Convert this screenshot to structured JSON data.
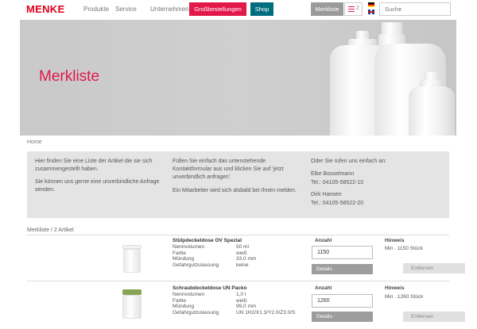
{
  "header": {
    "logo": "MENKE",
    "nav": [
      "Produkte",
      "Service",
      "Unternehmen"
    ],
    "gross_label": "Großbestellungen",
    "shop_label": "Shop",
    "merkliste_label": "Merkliste",
    "merkliste_count": "2",
    "search_placeholder": "Suche",
    "languages": [
      "de-flag",
      "en-flag"
    ]
  },
  "hero": {
    "title": "Merkliste"
  },
  "breadcrumb": "Home",
  "info": {
    "col1_p1": "Hier finden Sie eine Liste der Artikel die sie sich zusammengestellt haben.",
    "col1_p2": "Sie können uns gerne eine unverbindliche Anfrage senden.",
    "col2_p1": "Füllen Sie einfach das untenstehende Kontaktformular aus und klicken Sie auf 'jetzt unverbindlich anfragen'.",
    "col2_p2": "Ein Mitarbeiter wird sich alsbald bei Ihnen melden.",
    "col3_intro": "Oder Sie rufen uns einfach an:",
    "contact1_name": "Elke Bosselmann",
    "contact1_tel": "Tel.: 04105-58522-10",
    "contact2_name": "Dirk Hansen",
    "contact2_tel": "Tel.: 04105-58522-20"
  },
  "cart_title": "Merkliste / 2 Artikel",
  "labels": {
    "nennvolumen": "Nennvolumen",
    "farbe": "Farbe",
    "muendung": "Mündung",
    "gefahrgut": "Gefahrgutzulassung",
    "anzahl": "Anzahl",
    "hinweis": "Hinweis",
    "details": "Details",
    "entfernen": "Entfernen"
  },
  "products": [
    {
      "name": "Stülpdeckeldose OV Spezial",
      "nennvolumen": "50 ml",
      "farbe": "weiß",
      "muendung": "33,0 mm",
      "gefahrgut": "keine",
      "qty": "1150",
      "hinweis": "Min . 1150 Stück",
      "cap_color": "#f2f2f2"
    },
    {
      "name": "Schraubdeckeldose UN Packo",
      "nennvolumen": "1,0 l",
      "farbe": "weiß",
      "muendung": "99,0 mm",
      "gefahrgut": "UN 1H2/X1.3/Y2.0/Z3.0/S",
      "qty": "1260",
      "hinweis": "Min . 1260 Stück",
      "cap_color": "#8aa85a"
    }
  ],
  "colors": {
    "brand_red": "#e2001a",
    "accent_pink": "#e2184b",
    "shop_teal": "#006e7f"
  }
}
